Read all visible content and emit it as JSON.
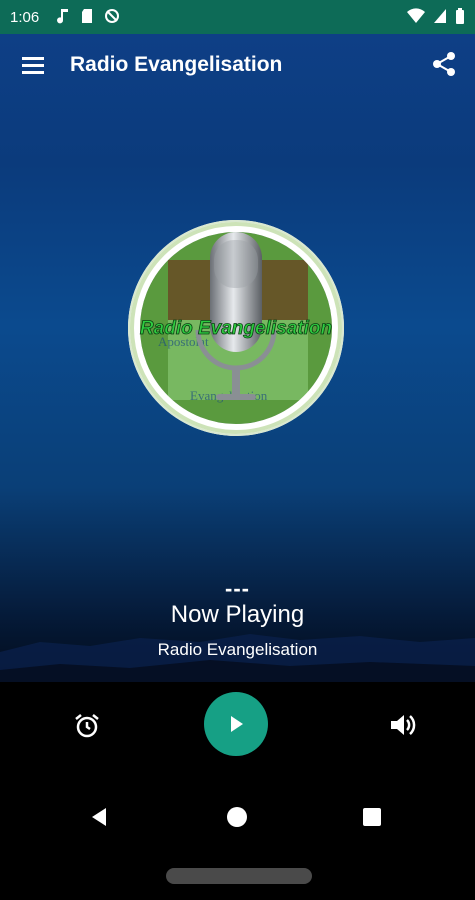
{
  "status_bar": {
    "time": "1:06",
    "left_icons": [
      "music-note-icon",
      "sd-card-icon",
      "no-sync-icon"
    ],
    "right_icons": [
      "wifi-icon",
      "cell-signal-icon",
      "battery-icon"
    ],
    "background": "#0d6b57"
  },
  "app_bar": {
    "title": "Radio Evangelisation",
    "menu_icon": "menu-icon",
    "share_icon": "share-icon"
  },
  "logo": {
    "text": "Radio Evangelisation",
    "bg_text_1": "Apostolat",
    "bg_text_2": "Evangelisation"
  },
  "now_playing": {
    "placeholder": "---",
    "title": "Now Playing",
    "station": "Radio Evangelisation"
  },
  "controls": {
    "alarm_icon": "alarm-icon",
    "play_icon": "play-icon",
    "volume_icon": "volume-icon",
    "accent": "#16a085"
  },
  "nav_bar": {
    "back_icon": "back-icon",
    "home_icon": "home-icon",
    "recents_icon": "recents-icon"
  }
}
